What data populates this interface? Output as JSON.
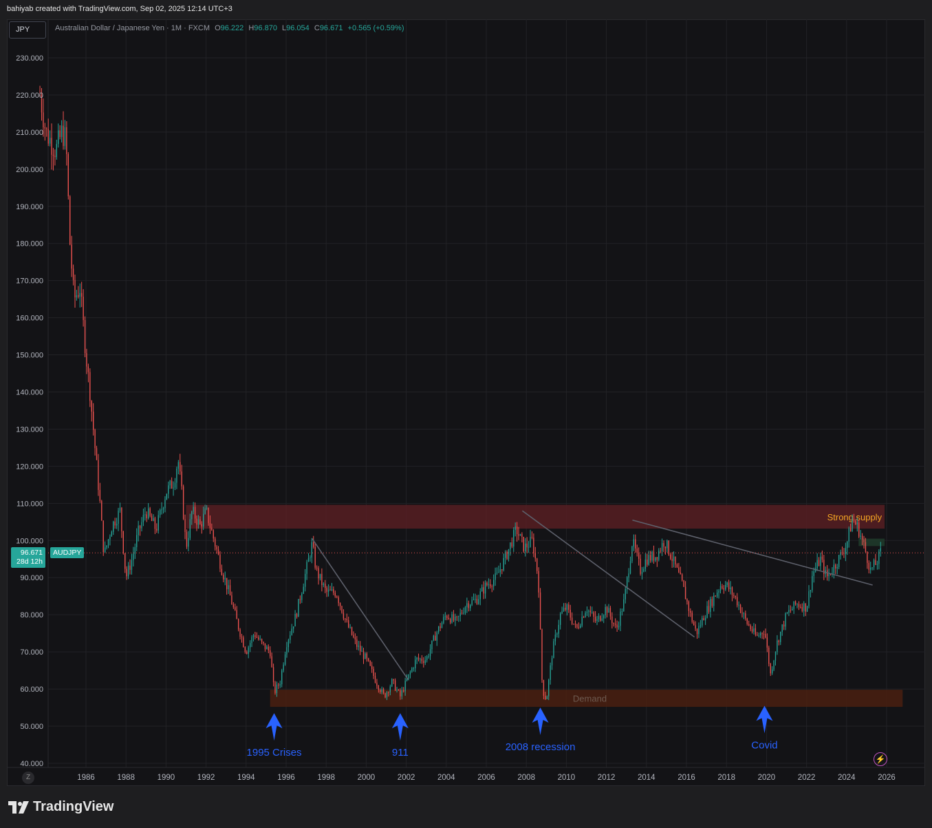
{
  "header": {
    "attribution": "bahiyab created with TradingView.com, Sep 02, 2025 12:14 UTC+3"
  },
  "toolbar": {
    "symbol_button": "JPY"
  },
  "legend": {
    "description": "Australian Dollar / Japanese Yen · 1M · FXCM",
    "open_key": "O",
    "open": "96.222",
    "high_key": "H",
    "high": "96.870",
    "low_key": "L",
    "low": "96.054",
    "close_key": "C",
    "close": "96.671",
    "change": "+0.565 (+0.59%)"
  },
  "price_badge": {
    "price": "96.671",
    "countdown": "28d 12h",
    "symbol": "AUDJPY"
  },
  "footer": {
    "brand": "TradingView",
    "z_button": "Z"
  },
  "colors": {
    "up": "#26a69a",
    "down": "#ef5350",
    "annotation": "#2962ff",
    "supply_zone": "#5c1f24",
    "demand_zone": "#4a2010"
  },
  "chart_data": {
    "type": "candlestick",
    "symbol": "AUDJPY",
    "interval": "1M",
    "ylim": [
      40,
      230
    ],
    "xlim": [
      1983.6,
      2026.8
    ],
    "y_ticks": [
      "230.000",
      "220.000",
      "210.000",
      "200.000",
      "190.000",
      "180.000",
      "170.000",
      "160.000",
      "150.000",
      "140.000",
      "130.000",
      "120.000",
      "110.000",
      "100.000",
      "90.000",
      "80.000",
      "70.000",
      "60.000",
      "50.000",
      "40.000"
    ],
    "x_ticks": [
      "1986",
      "1988",
      "1990",
      "1992",
      "1994",
      "1996",
      "1998",
      "2000",
      "2002",
      "2004",
      "2006",
      "2008",
      "2010",
      "2012",
      "2014",
      "2016",
      "2018",
      "2020",
      "2022",
      "2024",
      "2026"
    ],
    "price_path": [
      [
        1983.7,
        220
      ],
      [
        1984.0,
        210
      ],
      [
        1984.5,
        205
      ],
      [
        1984.8,
        210
      ],
      [
        1985.0,
        208
      ],
      [
        1985.2,
        180
      ],
      [
        1985.4,
        165
      ],
      [
        1985.7,
        168
      ],
      [
        1986.0,
        150
      ],
      [
        1986.2,
        140
      ],
      [
        1986.4,
        128
      ],
      [
        1986.7,
        110
      ],
      [
        1986.9,
        96
      ],
      [
        1987.3,
        104
      ],
      [
        1987.7,
        108
      ],
      [
        1988.0,
        90
      ],
      [
        1988.3,
        95
      ],
      [
        1988.6,
        102
      ],
      [
        1989.0,
        108
      ],
      [
        1989.5,
        103
      ],
      [
        1990.0,
        113
      ],
      [
        1990.4,
        116
      ],
      [
        1990.6,
        122
      ],
      [
        1990.8,
        112
      ],
      [
        1991.0,
        98
      ],
      [
        1991.3,
        108
      ],
      [
        1991.7,
        104
      ],
      [
        1992.0,
        108
      ],
      [
        1992.4,
        100
      ],
      [
        1992.8,
        92
      ],
      [
        1993.2,
        85
      ],
      [
        1993.6,
        77
      ],
      [
        1994.0,
        70
      ],
      [
        1994.4,
        75
      ],
      [
        1994.8,
        72
      ],
      [
        1995.2,
        70
      ],
      [
        1995.4,
        59
      ],
      [
        1995.7,
        62
      ],
      [
        1996.0,
        72
      ],
      [
        1996.5,
        80
      ],
      [
        1997.0,
        92
      ],
      [
        1997.3,
        99
      ],
      [
        1997.5,
        92
      ],
      [
        1998.0,
        86
      ],
      [
        1998.5,
        86
      ],
      [
        1999.0,
        78
      ],
      [
        1999.5,
        72
      ],
      [
        2000.0,
        68
      ],
      [
        2000.5,
        62
      ],
      [
        2000.9,
        58
      ],
      [
        2001.3,
        62
      ],
      [
        2001.7,
        58
      ],
      [
        2002.0,
        62
      ],
      [
        2002.5,
        68
      ],
      [
        2003.0,
        68
      ],
      [
        2003.5,
        75
      ],
      [
        2004.0,
        80
      ],
      [
        2004.5,
        78
      ],
      [
        2005.0,
        83
      ],
      [
        2005.5,
        84
      ],
      [
        2006.0,
        88
      ],
      [
        2006.5,
        90
      ],
      [
        2007.0,
        96
      ],
      [
        2007.5,
        103
      ],
      [
        2007.9,
        98
      ],
      [
        2008.3,
        100
      ],
      [
        2008.6,
        90
      ],
      [
        2008.8,
        60
      ],
      [
        2009.0,
        57
      ],
      [
        2009.3,
        70
      ],
      [
        2009.7,
        80
      ],
      [
        2010.0,
        82
      ],
      [
        2010.5,
        76
      ],
      [
        2011.0,
        82
      ],
      [
        2011.5,
        78
      ],
      [
        2012.0,
        82
      ],
      [
        2012.5,
        76
      ],
      [
        2012.9,
        84
      ],
      [
        2013.3,
        100
      ],
      [
        2013.7,
        92
      ],
      [
        2014.0,
        95
      ],
      [
        2014.5,
        96
      ],
      [
        2014.9,
        100
      ],
      [
        2015.3,
        95
      ],
      [
        2015.8,
        88
      ],
      [
        2016.2,
        80
      ],
      [
        2016.5,
        75
      ],
      [
        2016.9,
        80
      ],
      [
        2017.3,
        84
      ],
      [
        2017.7,
        88
      ],
      [
        2018.0,
        88
      ],
      [
        2018.5,
        84
      ],
      [
        2019.0,
        78
      ],
      [
        2019.5,
        74
      ],
      [
        2019.9,
        76
      ],
      [
        2020.2,
        64
      ],
      [
        2020.5,
        72
      ],
      [
        2021.0,
        80
      ],
      [
        2021.5,
        83
      ],
      [
        2022.0,
        82
      ],
      [
        2022.3,
        91
      ],
      [
        2022.7,
        95
      ],
      [
        2023.0,
        90
      ],
      [
        2023.5,
        94
      ],
      [
        2024.0,
        99
      ],
      [
        2024.3,
        106
      ],
      [
        2024.6,
        103
      ],
      [
        2024.9,
        98
      ],
      [
        2025.2,
        92
      ],
      [
        2025.5,
        94
      ],
      [
        2025.7,
        96.67
      ]
    ],
    "last_price": 96.671,
    "zones": [
      {
        "label": "Strong supply",
        "x0": 1991.0,
        "x1": 2025.9,
        "y0": 103.2,
        "y1": 109.6
      },
      {
        "label": "Demand",
        "x0": 1995.2,
        "x1": 2026.8,
        "y0": 55.2,
        "y1": 59.8
      }
    ],
    "trendlines": [
      {
        "from": [
          1997.3,
          100.5
        ],
        "to": [
          2002.1,
          62.5
        ]
      },
      {
        "from": [
          2007.8,
          108.0
        ],
        "to": [
          2016.4,
          74.0
        ]
      },
      {
        "from": [
          2013.3,
          105.5
        ],
        "to": [
          2025.3,
          88.0
        ]
      }
    ],
    "annotations": [
      {
        "label": "1995 Crises",
        "x": 1995.4,
        "arrow_tip": 53.5
      },
      {
        "label": "911",
        "x": 2001.7,
        "arrow_tip": 53.5
      },
      {
        "label": "2008 recession",
        "x": 2008.7,
        "arrow_tip": 55.0
      },
      {
        "label": "Covid",
        "x": 2019.9,
        "arrow_tip": 55.5
      }
    ]
  }
}
